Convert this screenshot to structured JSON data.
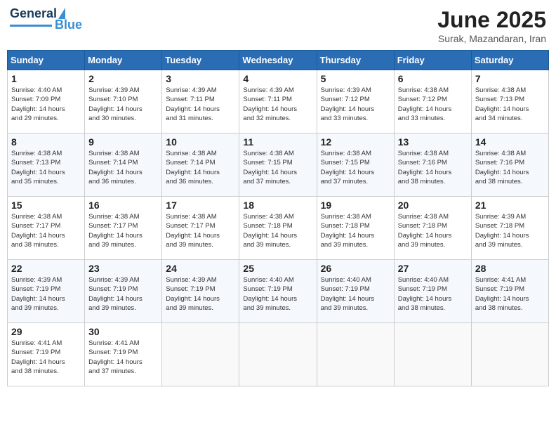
{
  "header": {
    "logo_general": "General",
    "logo_blue": "Blue",
    "month_title": "June 2025",
    "location": "Surak, Mazandaran, Iran"
  },
  "weekdays": [
    "Sunday",
    "Monday",
    "Tuesday",
    "Wednesday",
    "Thursday",
    "Friday",
    "Saturday"
  ],
  "weeks": [
    [
      {
        "day": "1",
        "info": "Sunrise: 4:40 AM\nSunset: 7:09 PM\nDaylight: 14 hours\nand 29 minutes."
      },
      {
        "day": "2",
        "info": "Sunrise: 4:39 AM\nSunset: 7:10 PM\nDaylight: 14 hours\nand 30 minutes."
      },
      {
        "day": "3",
        "info": "Sunrise: 4:39 AM\nSunset: 7:11 PM\nDaylight: 14 hours\nand 31 minutes."
      },
      {
        "day": "4",
        "info": "Sunrise: 4:39 AM\nSunset: 7:11 PM\nDaylight: 14 hours\nand 32 minutes."
      },
      {
        "day": "5",
        "info": "Sunrise: 4:39 AM\nSunset: 7:12 PM\nDaylight: 14 hours\nand 33 minutes."
      },
      {
        "day": "6",
        "info": "Sunrise: 4:38 AM\nSunset: 7:12 PM\nDaylight: 14 hours\nand 33 minutes."
      },
      {
        "day": "7",
        "info": "Sunrise: 4:38 AM\nSunset: 7:13 PM\nDaylight: 14 hours\nand 34 minutes."
      }
    ],
    [
      {
        "day": "8",
        "info": "Sunrise: 4:38 AM\nSunset: 7:13 PM\nDaylight: 14 hours\nand 35 minutes."
      },
      {
        "day": "9",
        "info": "Sunrise: 4:38 AM\nSunset: 7:14 PM\nDaylight: 14 hours\nand 36 minutes."
      },
      {
        "day": "10",
        "info": "Sunrise: 4:38 AM\nSunset: 7:14 PM\nDaylight: 14 hours\nand 36 minutes."
      },
      {
        "day": "11",
        "info": "Sunrise: 4:38 AM\nSunset: 7:15 PM\nDaylight: 14 hours\nand 37 minutes."
      },
      {
        "day": "12",
        "info": "Sunrise: 4:38 AM\nSunset: 7:15 PM\nDaylight: 14 hours\nand 37 minutes."
      },
      {
        "day": "13",
        "info": "Sunrise: 4:38 AM\nSunset: 7:16 PM\nDaylight: 14 hours\nand 38 minutes."
      },
      {
        "day": "14",
        "info": "Sunrise: 4:38 AM\nSunset: 7:16 PM\nDaylight: 14 hours\nand 38 minutes."
      }
    ],
    [
      {
        "day": "15",
        "info": "Sunrise: 4:38 AM\nSunset: 7:17 PM\nDaylight: 14 hours\nand 38 minutes."
      },
      {
        "day": "16",
        "info": "Sunrise: 4:38 AM\nSunset: 7:17 PM\nDaylight: 14 hours\nand 39 minutes."
      },
      {
        "day": "17",
        "info": "Sunrise: 4:38 AM\nSunset: 7:17 PM\nDaylight: 14 hours\nand 39 minutes."
      },
      {
        "day": "18",
        "info": "Sunrise: 4:38 AM\nSunset: 7:18 PM\nDaylight: 14 hours\nand 39 minutes."
      },
      {
        "day": "19",
        "info": "Sunrise: 4:38 AM\nSunset: 7:18 PM\nDaylight: 14 hours\nand 39 minutes."
      },
      {
        "day": "20",
        "info": "Sunrise: 4:38 AM\nSunset: 7:18 PM\nDaylight: 14 hours\nand 39 minutes."
      },
      {
        "day": "21",
        "info": "Sunrise: 4:39 AM\nSunset: 7:18 PM\nDaylight: 14 hours\nand 39 minutes."
      }
    ],
    [
      {
        "day": "22",
        "info": "Sunrise: 4:39 AM\nSunset: 7:19 PM\nDaylight: 14 hours\nand 39 minutes."
      },
      {
        "day": "23",
        "info": "Sunrise: 4:39 AM\nSunset: 7:19 PM\nDaylight: 14 hours\nand 39 minutes."
      },
      {
        "day": "24",
        "info": "Sunrise: 4:39 AM\nSunset: 7:19 PM\nDaylight: 14 hours\nand 39 minutes."
      },
      {
        "day": "25",
        "info": "Sunrise: 4:40 AM\nSunset: 7:19 PM\nDaylight: 14 hours\nand 39 minutes."
      },
      {
        "day": "26",
        "info": "Sunrise: 4:40 AM\nSunset: 7:19 PM\nDaylight: 14 hours\nand 39 minutes."
      },
      {
        "day": "27",
        "info": "Sunrise: 4:40 AM\nSunset: 7:19 PM\nDaylight: 14 hours\nand 38 minutes."
      },
      {
        "day": "28",
        "info": "Sunrise: 4:41 AM\nSunset: 7:19 PM\nDaylight: 14 hours\nand 38 minutes."
      }
    ],
    [
      {
        "day": "29",
        "info": "Sunrise: 4:41 AM\nSunset: 7:19 PM\nDaylight: 14 hours\nand 38 minutes."
      },
      {
        "day": "30",
        "info": "Sunrise: 4:41 AM\nSunset: 7:19 PM\nDaylight: 14 hours\nand 37 minutes."
      },
      {
        "day": "",
        "info": ""
      },
      {
        "day": "",
        "info": ""
      },
      {
        "day": "",
        "info": ""
      },
      {
        "day": "",
        "info": ""
      },
      {
        "day": "",
        "info": ""
      }
    ]
  ]
}
